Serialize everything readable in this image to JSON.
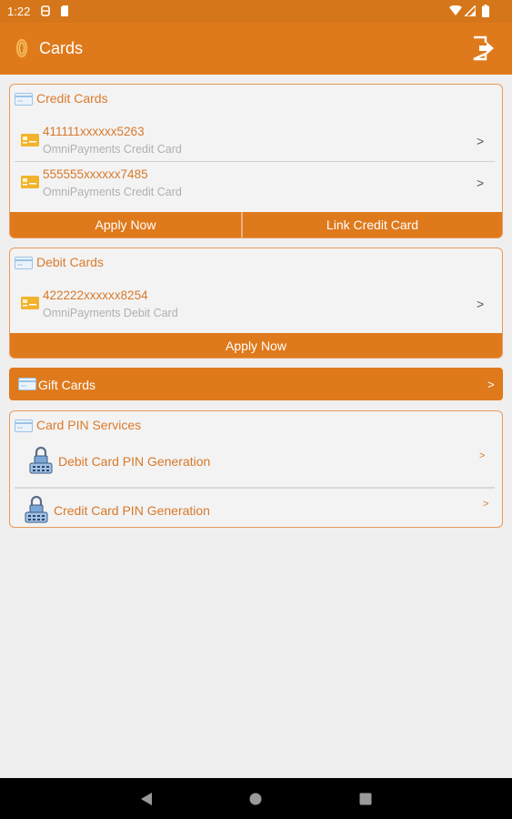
{
  "status_bar": {
    "time": "1:22"
  },
  "app_bar": {
    "title": "Cards"
  },
  "credit_cards": {
    "title": "Credit Cards",
    "items": [
      {
        "number": "411111xxxxxx5263",
        "type": "OmniPayments Credit Card",
        "chevron": ">"
      },
      {
        "number": "555555xxxxxx7485",
        "type": "OmniPayments Credit Card",
        "chevron": ">"
      }
    ],
    "apply_label": "Apply Now",
    "link_label": "Link Credit Card"
  },
  "debit_cards": {
    "title": "Debit Cards",
    "items": [
      {
        "number": "422222xxxxxx8254",
        "type": "OmniPayments Debit Card",
        "chevron": ">"
      }
    ],
    "apply_label": "Apply Now"
  },
  "gift_cards": {
    "title": "Gift Cards",
    "chevron": ">"
  },
  "pin_services": {
    "title": "Card PIN Services",
    "items": [
      {
        "label": "Debit Card PIN Generation",
        "chevron": ">"
      },
      {
        "label": "Credit Card PIN Generation",
        "chevron": ">"
      }
    ]
  },
  "colors": {
    "primary": "#df7a1c",
    "accent_text": "#d7792a",
    "background": "#efefef",
    "nav_bar": "#000000"
  }
}
